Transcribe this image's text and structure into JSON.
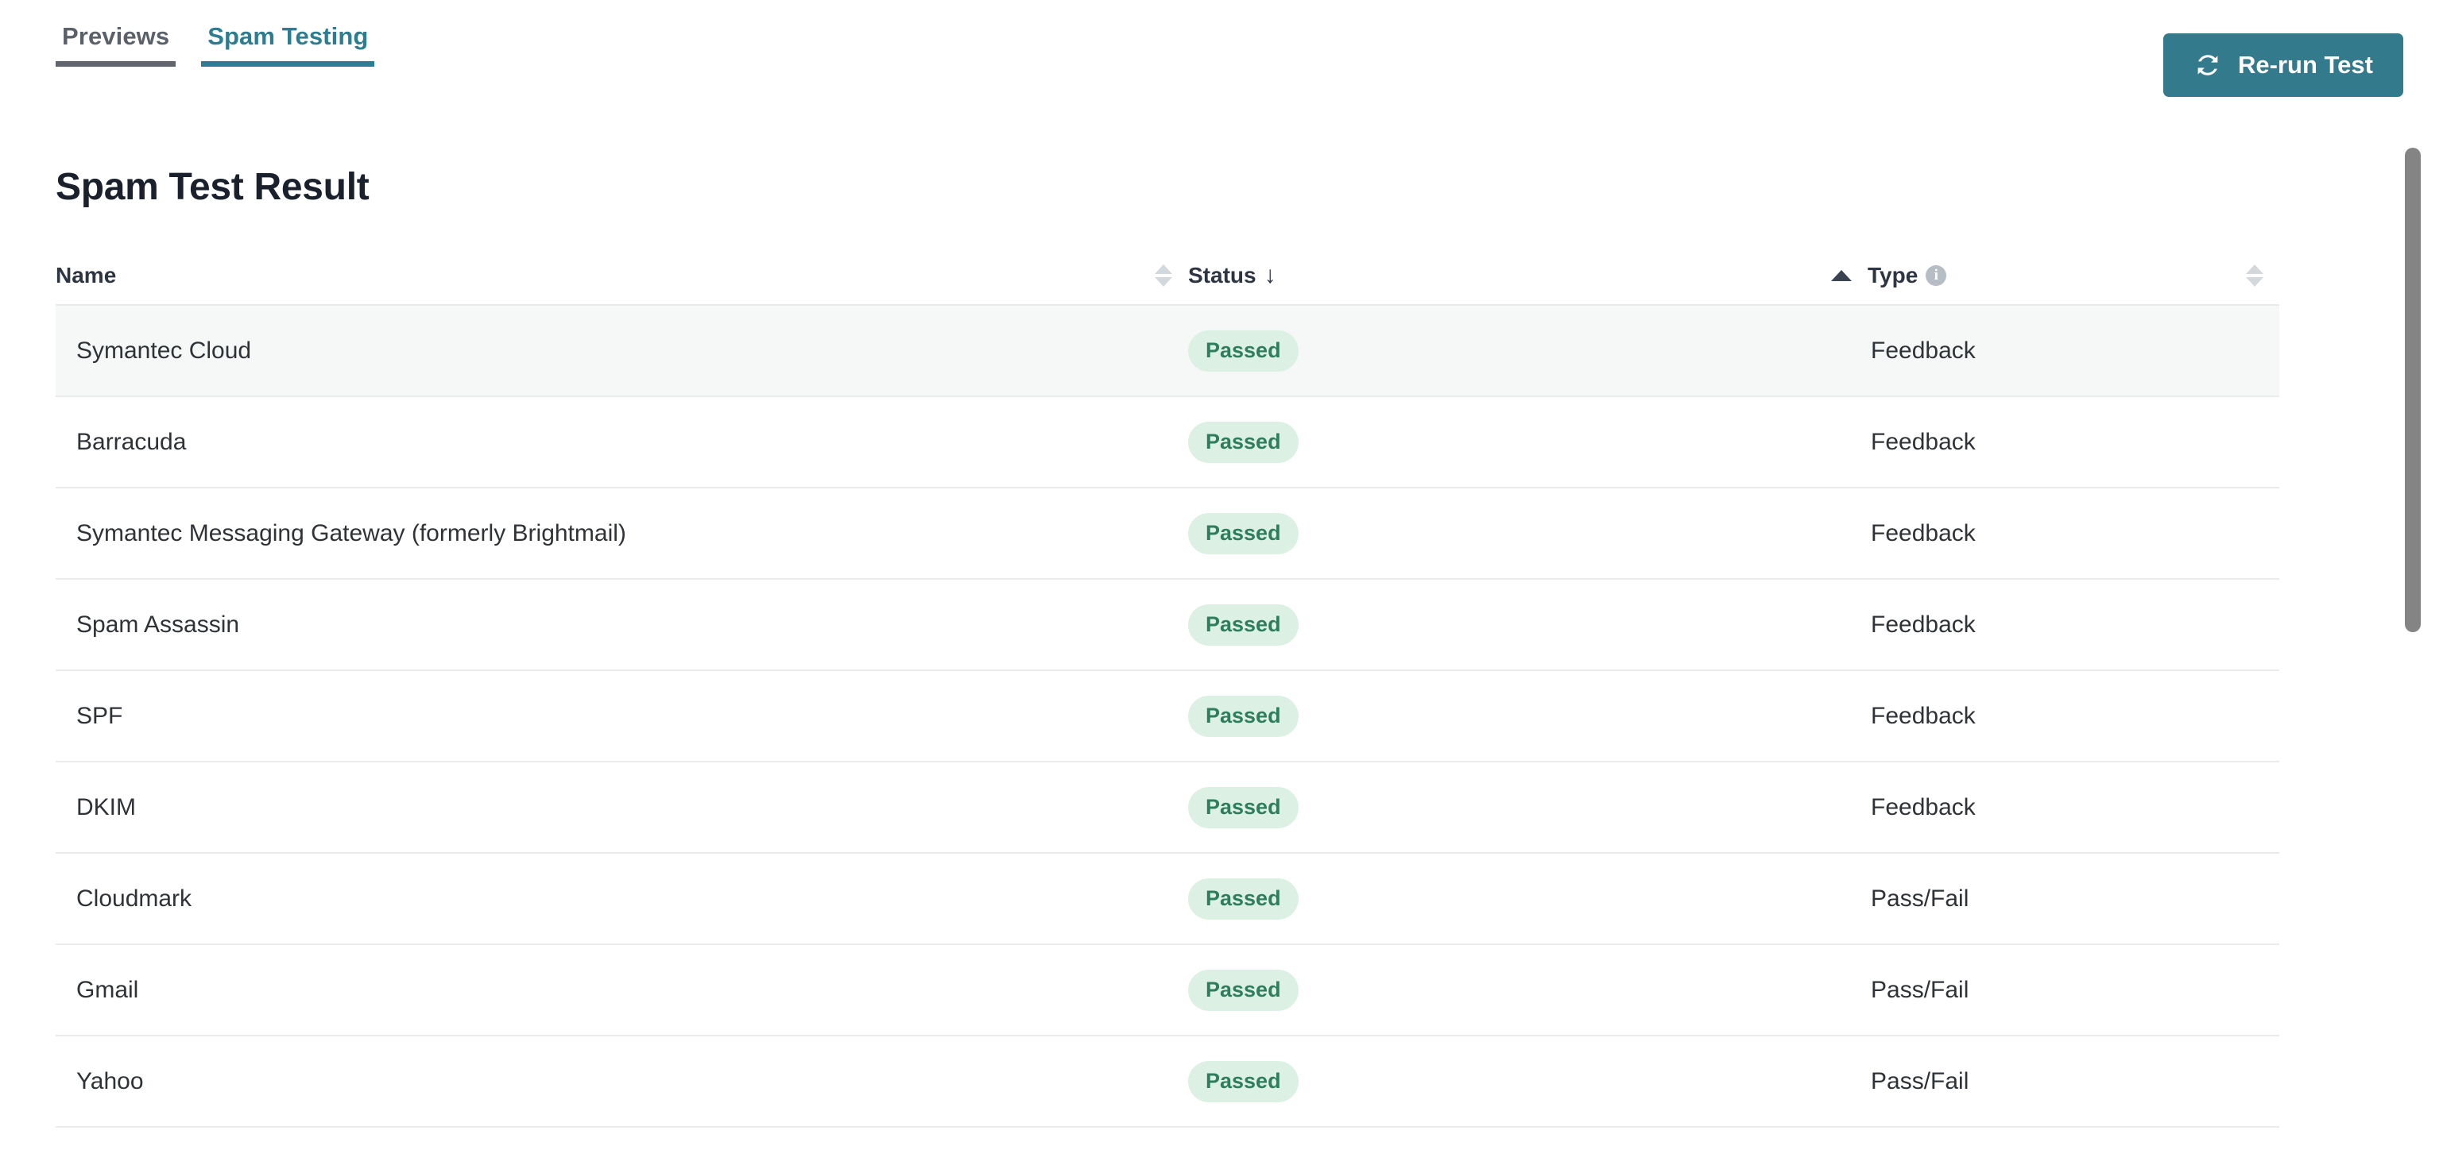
{
  "tabs": [
    {
      "label": "Previews",
      "active": false,
      "name": "tab-previews"
    },
    {
      "label": "Spam Testing",
      "active": true,
      "name": "tab-spam-testing"
    }
  ],
  "toolbar": {
    "rerun_label": "Re-run Test",
    "rerun_icon": "refresh-icon",
    "accent_color": "#337a8c"
  },
  "page": {
    "title": "Spam Test Result"
  },
  "table": {
    "columns": [
      {
        "label": "Name",
        "sort": "none",
        "sort_icon": "sort-neutral-icon",
        "info": false
      },
      {
        "label": "Status",
        "sort": "desc",
        "sort_icon": "arrow-down-icon",
        "trailing_sort": "asc",
        "info": false
      },
      {
        "label": "Type",
        "sort": "none",
        "sort_icon": "sort-neutral-icon",
        "info": true,
        "info_icon": "info-icon"
      }
    ],
    "rows": [
      {
        "name": "Symantec Cloud",
        "status": "Passed",
        "type": "Feedback",
        "highlighted": true
      },
      {
        "name": "Barracuda",
        "status": "Passed",
        "type": "Feedback",
        "highlighted": false
      },
      {
        "name": "Symantec Messaging Gateway (formerly Brightmail)",
        "status": "Passed",
        "type": "Feedback",
        "highlighted": false
      },
      {
        "name": "Spam Assassin",
        "status": "Passed",
        "type": "Feedback",
        "highlighted": false
      },
      {
        "name": "SPF",
        "status": "Passed",
        "type": "Feedback",
        "highlighted": false
      },
      {
        "name": "DKIM",
        "status": "Passed",
        "type": "Feedback",
        "highlighted": false
      },
      {
        "name": "Cloudmark",
        "status": "Passed",
        "type": "Pass/Fail",
        "highlighted": false
      },
      {
        "name": "Gmail",
        "status": "Passed",
        "type": "Pass/Fail",
        "highlighted": false
      },
      {
        "name": "Yahoo",
        "status": "Passed",
        "type": "Pass/Fail",
        "highlighted": false
      }
    ],
    "badge_colors": {
      "passed_bg": "#dcf1e4",
      "passed_text": "#2e7d5b"
    }
  },
  "scrollbar": {
    "orientation": "vertical",
    "thumb_color": "#848484"
  }
}
